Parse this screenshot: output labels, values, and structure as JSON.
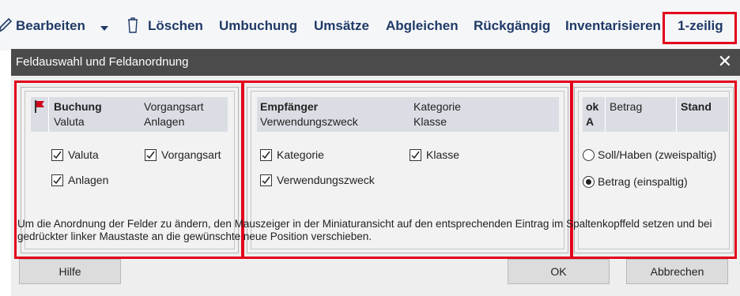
{
  "toolbar": {
    "edit_label": "Bearbeiten",
    "delete_label": "Löschen",
    "transfer_label": "Umbuchung",
    "sales_label": "Umsätze",
    "reconcile_label": "Abgleichen",
    "undo_label": "Rückgängig",
    "inventory_label": "Inventarisieren",
    "oneline_label": "1-zeilig"
  },
  "dialog": {
    "title": "Feldauswahl und Feldanordnung",
    "close_glyph": "✕",
    "panel1": {
      "mini_fields": [
        "Buchung",
        "Vorgangsart",
        "Valuta",
        "Anlagen"
      ],
      "checkboxes": [
        {
          "label": "Valuta",
          "checked": true
        },
        {
          "label": "Vorgangsart",
          "checked": true
        },
        {
          "label": "Anlagen",
          "checked": true
        }
      ]
    },
    "panel2": {
      "mini_fields": [
        "Empfänger",
        "Kategorie",
        "Verwendungszweck",
        "Klasse"
      ],
      "checkboxes": [
        {
          "label": "Kategorie",
          "checked": true
        },
        {
          "label": "Klasse",
          "checked": true
        },
        {
          "label": "Verwendungszweck",
          "checked": true
        }
      ]
    },
    "panel3": {
      "mini_headers": [
        "ok",
        "Betrag",
        "Stand"
      ],
      "mini_row": [
        "A",
        "",
        ""
      ],
      "radios": [
        {
          "label": "Soll/Haben (zweispaltig)",
          "selected": false
        },
        {
          "label": "Betrag (einspaltig)",
          "selected": true
        }
      ]
    },
    "description": "Um die Anordnung der Felder zu ändern, den Mauszeiger in der Miniaturansicht auf den entsprechenden Eintrag im Spaltenkopffeld setzen und bei gedrückter linker Maustaste an die gewünschte neue Position verschieben.",
    "buttons": {
      "help": "Hilfe",
      "ok": "OK",
      "cancel": "Abbrechen"
    }
  },
  "colors": {
    "highlight": "#e3001b",
    "toolbar_text": "#1f3a67",
    "titlebar": "#4b4b4b",
    "flag": "#d0021b"
  },
  "icons": [
    "pencil-icon",
    "dropdown-arrow-icon",
    "trash-icon",
    "flag-icon",
    "close-icon",
    "checkbox-check-icon"
  ]
}
